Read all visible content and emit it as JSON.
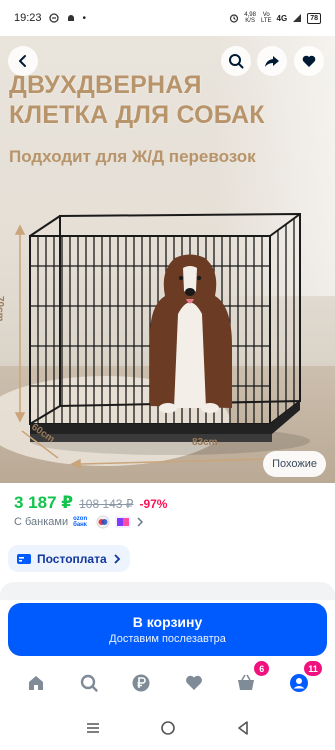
{
  "status_bar": {
    "time": "19:23",
    "speed_value": "4,98",
    "speed_unit": "K/S",
    "vo_label": "Vo",
    "lte_label": "LTE",
    "network": "4G",
    "battery": "78"
  },
  "hero": {
    "title_line1": "ДВУХДВЕРНАЯ",
    "title_line2": "КЛЕТКА ДЛЯ СОБАК",
    "subtitle": "Подходит для Ж/Д перевозок",
    "dim_height": "70cm",
    "dim_depth": "60cm",
    "dim_width": "83cm",
    "similar_label": "Похожие"
  },
  "price": {
    "current": "3 187 ₽",
    "old": "108 143 ₽",
    "discount": "-97%",
    "banks_label": "С банками",
    "ozon_bank_line1": "ozon",
    "ozon_bank_line2": "банк"
  },
  "payment": {
    "label": "Постоплата"
  },
  "cart": {
    "label": "В корзину",
    "delivery": "Доставим послезавтра"
  },
  "bottom_nav": {
    "cart_badge": "6",
    "profile_badge": "11"
  },
  "colors": {
    "accent": "#005bff",
    "price_green": "#10c44c",
    "discount_red": "#f91155",
    "badge_pink": "#f1117e"
  }
}
